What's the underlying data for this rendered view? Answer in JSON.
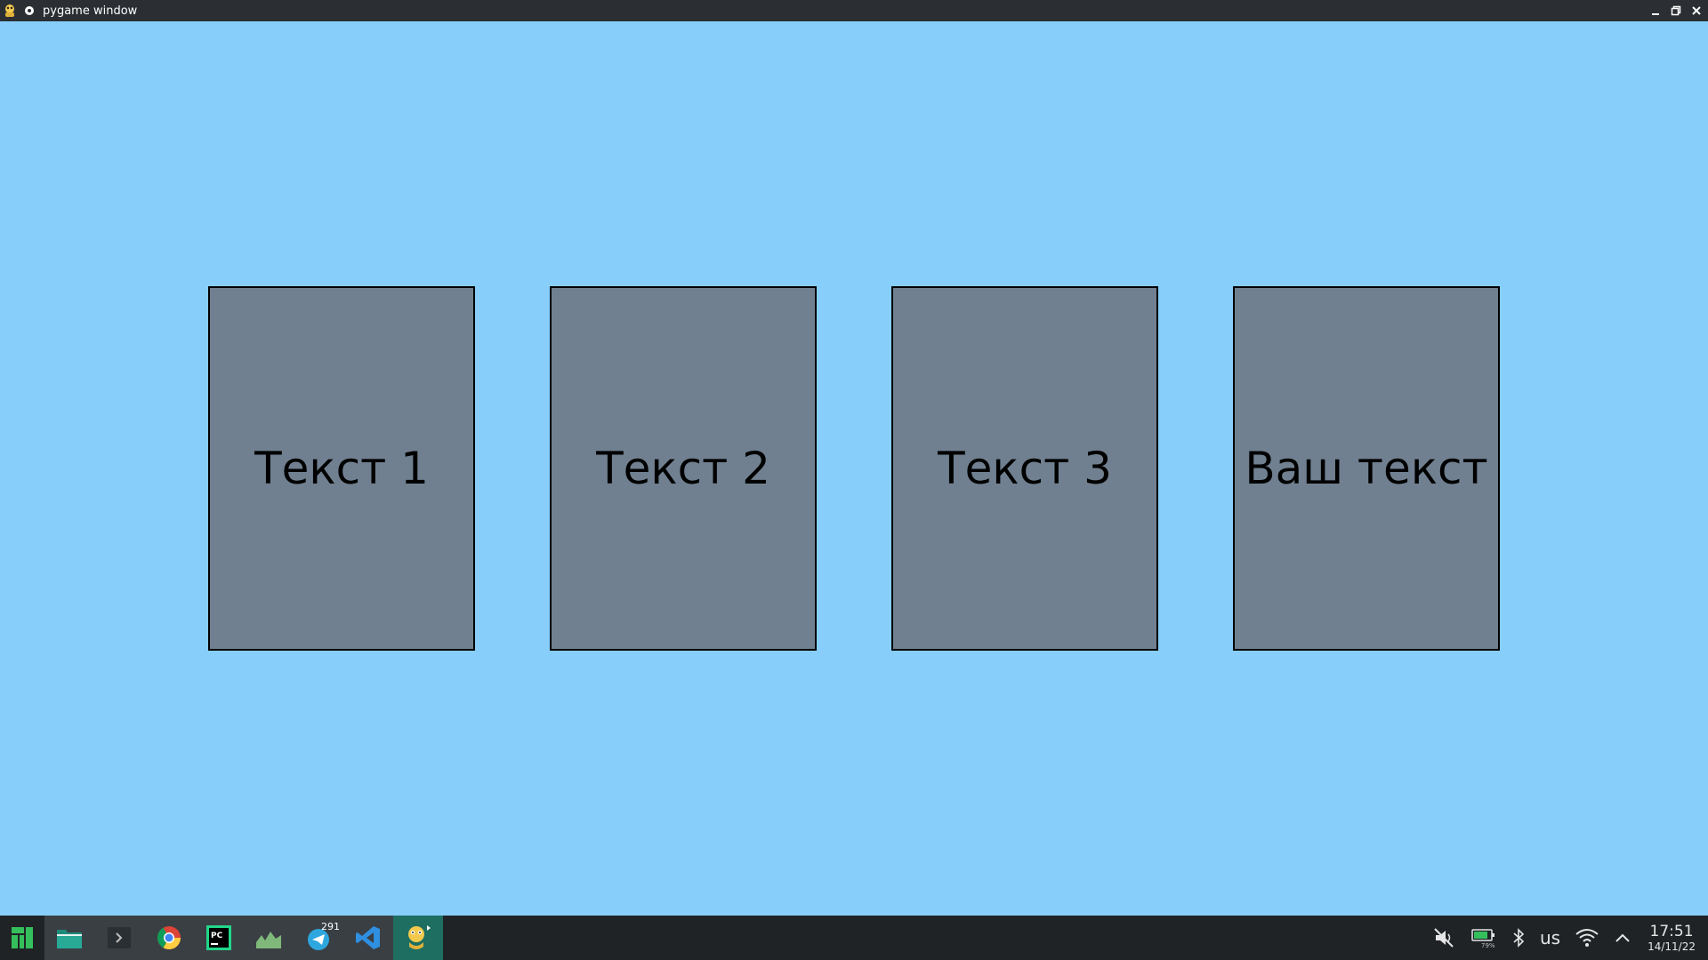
{
  "window": {
    "title": "pygame window",
    "controls": {
      "minimize_icon": "minimize-icon",
      "restore_icon": "restore-icon",
      "close_icon": "close-icon"
    }
  },
  "game": {
    "background": "#87cefa",
    "card_color": "#708090",
    "cards": [
      {
        "label": "Текст 1"
      },
      {
        "label": "Текст 2"
      },
      {
        "label": "Текст 3"
      },
      {
        "label": "Ваш текст"
      }
    ]
  },
  "taskbar": {
    "apps": [
      {
        "name": "manjaro-menu-icon"
      },
      {
        "name": "file-manager-icon"
      },
      {
        "name": "terminal-icon"
      },
      {
        "name": "chrome-icon"
      },
      {
        "name": "pycharm-icon",
        "label": "PC"
      },
      {
        "name": "system-monitor-icon"
      },
      {
        "name": "telegram-icon",
        "badge": "291"
      },
      {
        "name": "vscode-icon"
      },
      {
        "name": "pygame-icon"
      }
    ],
    "tray": {
      "keyboard_layout": "us",
      "battery_percent": "79%"
    },
    "clock": {
      "time": "17:51",
      "date": "14/11/22"
    }
  }
}
